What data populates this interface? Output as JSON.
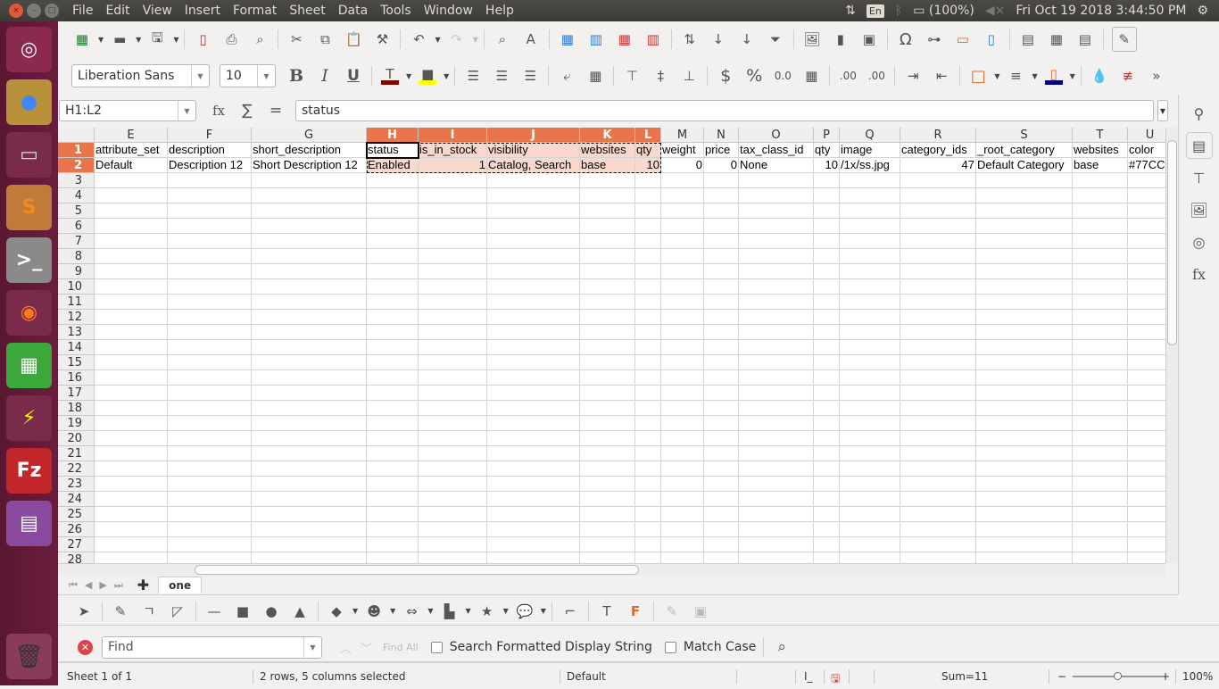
{
  "window": {
    "menus": [
      "File",
      "Edit",
      "View",
      "Insert",
      "Format",
      "Sheet",
      "Data",
      "Tools",
      "Window",
      "Help"
    ]
  },
  "tray": {
    "keyboard": "En",
    "battery": "(100%)",
    "clock": "Fri Oct 19 2018  3:44:50 PM"
  },
  "launcher": [
    {
      "name": "ubuntu-dash-icon",
      "glyph": "◎",
      "bg": "#8a2a4f",
      "fg": "#fff"
    },
    {
      "name": "chrome-icon",
      "glyph": "●",
      "bg": "#b9913a",
      "fg": "#4285f4"
    },
    {
      "name": "files-icon",
      "glyph": "▭",
      "bg": "#7a2a4a",
      "fg": "#ddd"
    },
    {
      "name": "sublime-text-icon",
      "glyph": "S",
      "bg": "#c07a3a",
      "fg": "#f48a1e"
    },
    {
      "name": "terminal-icon",
      "glyph": ">_",
      "bg": "#8a8a8a",
      "fg": "#fff"
    },
    {
      "name": "firefox-icon",
      "glyph": "◉",
      "bg": "#7a2a4a",
      "fg": "#ff7a1e"
    },
    {
      "name": "libreoffice-calc-icon",
      "glyph": "▦",
      "bg": "#3aa83a",
      "fg": "#fff"
    },
    {
      "name": "remote-desktop-icon",
      "glyph": "⚡",
      "bg": "#7a2a4a",
      "fg": "#ff0"
    },
    {
      "name": "filezilla-icon",
      "glyph": "Fz",
      "bg": "#c0262a",
      "fg": "#fff"
    },
    {
      "name": "app-window-icon",
      "glyph": "▤",
      "bg": "#8a4aa0",
      "fg": "#fff"
    }
  ],
  "trash": {
    "glyph": "🗑"
  },
  "format": {
    "font_name": "Liberation Sans",
    "font_size": "10",
    "font_color": "#7f0000",
    "highlight_color": "#ffff00",
    "border_color": "#000080"
  },
  "formula": {
    "name_box": "H1:L2",
    "content": "status",
    "fx": "fx",
    "sum": "∑",
    "eq": "="
  },
  "columns": [
    {
      "id": "E",
      "w": 82,
      "sel": false
    },
    {
      "id": "F",
      "w": 94,
      "sel": false
    },
    {
      "id": "G",
      "w": 129,
      "sel": false
    },
    {
      "id": "H",
      "w": 58,
      "sel": true
    },
    {
      "id": "I",
      "w": 77,
      "sel": true
    },
    {
      "id": "J",
      "w": 104,
      "sel": true
    },
    {
      "id": "K",
      "w": 62,
      "sel": true
    },
    {
      "id": "L",
      "w": 29,
      "sel": true
    },
    {
      "id": "M",
      "w": 48,
      "sel": false
    },
    {
      "id": "N",
      "w": 39,
      "sel": false
    },
    {
      "id": "O",
      "w": 84,
      "sel": false
    },
    {
      "id": "P",
      "w": 29,
      "sel": false
    },
    {
      "id": "Q",
      "w": 68,
      "sel": false
    },
    {
      "id": "R",
      "w": 85,
      "sel": false
    },
    {
      "id": "S",
      "w": 108,
      "sel": false
    },
    {
      "id": "T",
      "w": 62,
      "sel": false
    },
    {
      "id": "U",
      "w": 50,
      "sel": false
    }
  ],
  "rows": [
    [
      "attribute_set",
      "description",
      "short_description",
      "status",
      "is_in_stock",
      "visibility",
      "websites",
      "qty",
      "weight",
      "price",
      "tax_class_id",
      "qty",
      "image",
      "category_ids",
      "_root_category",
      "websites",
      "color"
    ],
    [
      "Default",
      "Description 12",
      "Short Description 12",
      "Enabled",
      "1",
      "Catalog, Search",
      "base",
      "10",
      "0",
      "0",
      "None",
      "10",
      "/1x/ss.jpg",
      "47",
      "Default Category",
      "base",
      "#77CC"
    ]
  ],
  "numeric_cols_row2": [
    4,
    7,
    8,
    9,
    11,
    13
  ],
  "row_numbers": [
    "1",
    "2",
    "3",
    "4",
    "5",
    "6",
    "7",
    "8",
    "9",
    "10",
    "11",
    "12",
    "13",
    "14",
    "15",
    "16",
    "17",
    "18",
    "19",
    "20",
    "21",
    "22",
    "23",
    "24",
    "25",
    "26",
    "27",
    "28"
  ],
  "sheet_tabs": {
    "active": "one"
  },
  "find": {
    "placeholder": "Find",
    "find_all": "Find All",
    "opt1": "Search Formatted Display String",
    "opt2": "Match Case"
  },
  "status": {
    "sheet": "Sheet 1 of 1",
    "selection": "2 rows, 5 columns selected",
    "style": "Default",
    "sum": "Sum=11",
    "zoom": "100%",
    "zoom_level_pct": 100
  }
}
